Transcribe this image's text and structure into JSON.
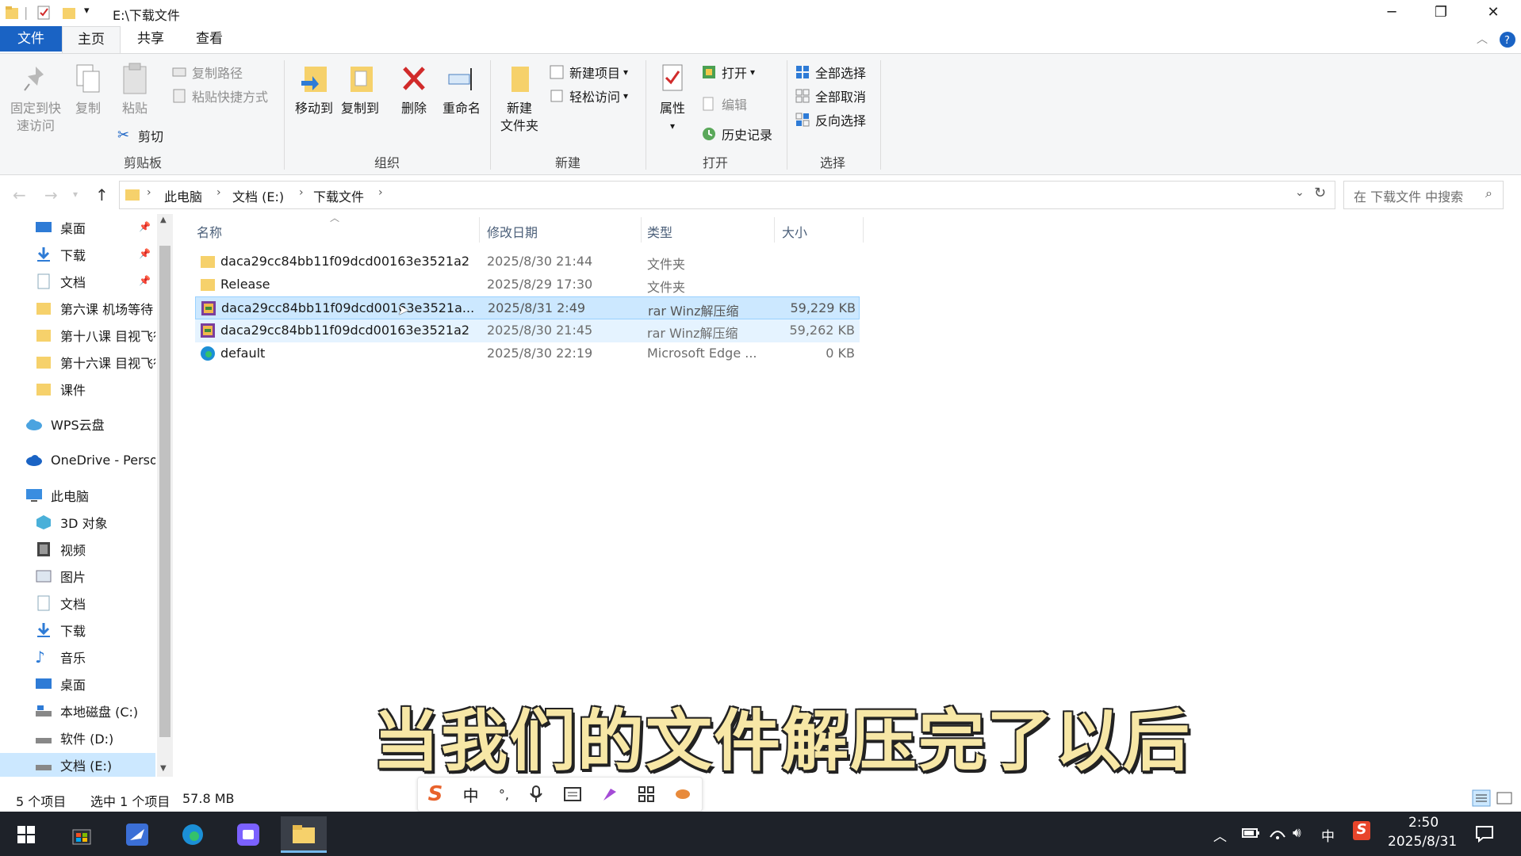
{
  "window": {
    "title": "E:\\下载文件",
    "minimize_glyph": "─",
    "restore_glyph": "❐",
    "close_glyph": "✕"
  },
  "ribbon_tabs": [
    "文件",
    "主页",
    "共享",
    "查看"
  ],
  "ribbon": {
    "clipboard": {
      "pin_label_1": "固定到快",
      "pin_label_2": "速访问",
      "copy": "复制",
      "paste": "粘贴",
      "copy_path": "复制路径",
      "paste_shortcut": "粘贴快捷方式",
      "cut": "剪切",
      "group": "剪贴板"
    },
    "organize": {
      "move_to": "移动到",
      "copy_to": "复制到",
      "delete": "删除",
      "rename": "重命名",
      "group": "组织"
    },
    "new": {
      "new_folder_1": "新建",
      "new_folder_2": "文件夹",
      "new_item": "新建项目",
      "easy_access": "轻松访问",
      "group": "新建"
    },
    "open": {
      "properties": "属性",
      "open": "打开",
      "edit": "编辑",
      "history": "历史记录",
      "group": "打开"
    },
    "select": {
      "select_all": "全部选择",
      "select_none": "全部取消",
      "invert": "反向选择",
      "group": "选择"
    }
  },
  "address": {
    "crumbs": [
      "此电脑",
      "文档 (E:)",
      "下载文件"
    ],
    "search_placeholder": "在 下载文件 中搜索"
  },
  "nav_pane": {
    "quick_access": [
      {
        "label": "桌面",
        "icon": "desktop-icon",
        "pinned": true
      },
      {
        "label": "下载",
        "icon": "download-icon",
        "pinned": true
      },
      {
        "label": "文档",
        "icon": "document-icon",
        "pinned": true
      },
      {
        "label": "第六课  机场等待",
        "icon": "folder-icon",
        "pinned": false
      },
      {
        "label": "第十八课  目视飞行",
        "icon": "folder-icon",
        "pinned": false
      },
      {
        "label": "第十六课  目视飞行",
        "icon": "folder-icon",
        "pinned": false
      },
      {
        "label": "课件",
        "icon": "folder-icon",
        "pinned": false
      }
    ],
    "wps": "WPS云盘",
    "onedrive": "OneDrive - Personal",
    "this_pc": "此电脑",
    "pc_items": [
      {
        "label": "3D 对象",
        "icon": "3d-objects-icon"
      },
      {
        "label": "视频",
        "icon": "video-icon"
      },
      {
        "label": "图片",
        "icon": "pictures-icon"
      },
      {
        "label": "文档",
        "icon": "document-icon"
      },
      {
        "label": "下载",
        "icon": "download-icon"
      },
      {
        "label": "音乐",
        "icon": "music-icon"
      },
      {
        "label": "桌面",
        "icon": "desktop-icon"
      },
      {
        "label": "本地磁盘 (C:)",
        "icon": "drive-c-icon"
      },
      {
        "label": "软件 (D:)",
        "icon": "drive-icon"
      },
      {
        "label": "文档 (E:)",
        "icon": "drive-icon"
      }
    ]
  },
  "file_list": {
    "columns": [
      "名称",
      "修改日期",
      "类型",
      "大小"
    ],
    "rows": [
      {
        "name": "daca29cc84bb11f09dcd00163e3521a2",
        "date": "2025/8/30 21:44",
        "type": "文件夹",
        "size": "",
        "icon": "folder-icon"
      },
      {
        "name": "Release",
        "date": "2025/8/29 17:30",
        "type": "文件夹",
        "size": "",
        "icon": "folder-icon"
      },
      {
        "name": "daca29cc84bb11f09dcd00163e3521a...",
        "date": "2025/8/31 2:49",
        "type": "rar Winz解压缩",
        "size": "59,229 KB",
        "icon": "rar-archive-icon"
      },
      {
        "name": "daca29cc84bb11f09dcd00163e3521a2",
        "date": "2025/8/30 21:45",
        "type": "rar Winz解压缩",
        "size": "59,262 KB",
        "icon": "rar-archive-icon"
      },
      {
        "name": "default",
        "date": "2025/8/30 22:19",
        "type": "Microsoft Edge ...",
        "size": "0 KB",
        "icon": "edge-icon"
      }
    ]
  },
  "subtitle": "当我们的文件解压完了以后",
  "status": {
    "count": "5 个项目",
    "selected": "选中 1 个项目",
    "selected_size": "57.8 MB"
  },
  "ime": [
    "S",
    "中",
    "°,",
    "mic",
    "keyboard",
    "skin",
    "grid",
    "tools"
  ],
  "taskbar": {
    "lang": "中",
    "time": "2:50",
    "date": "2025/8/31"
  },
  "colors": {
    "accent": "#1a63c4",
    "selected_row": "#cce8ff",
    "taskbar": "#1e2229",
    "subtitle_fill": "#f7e7a6"
  }
}
